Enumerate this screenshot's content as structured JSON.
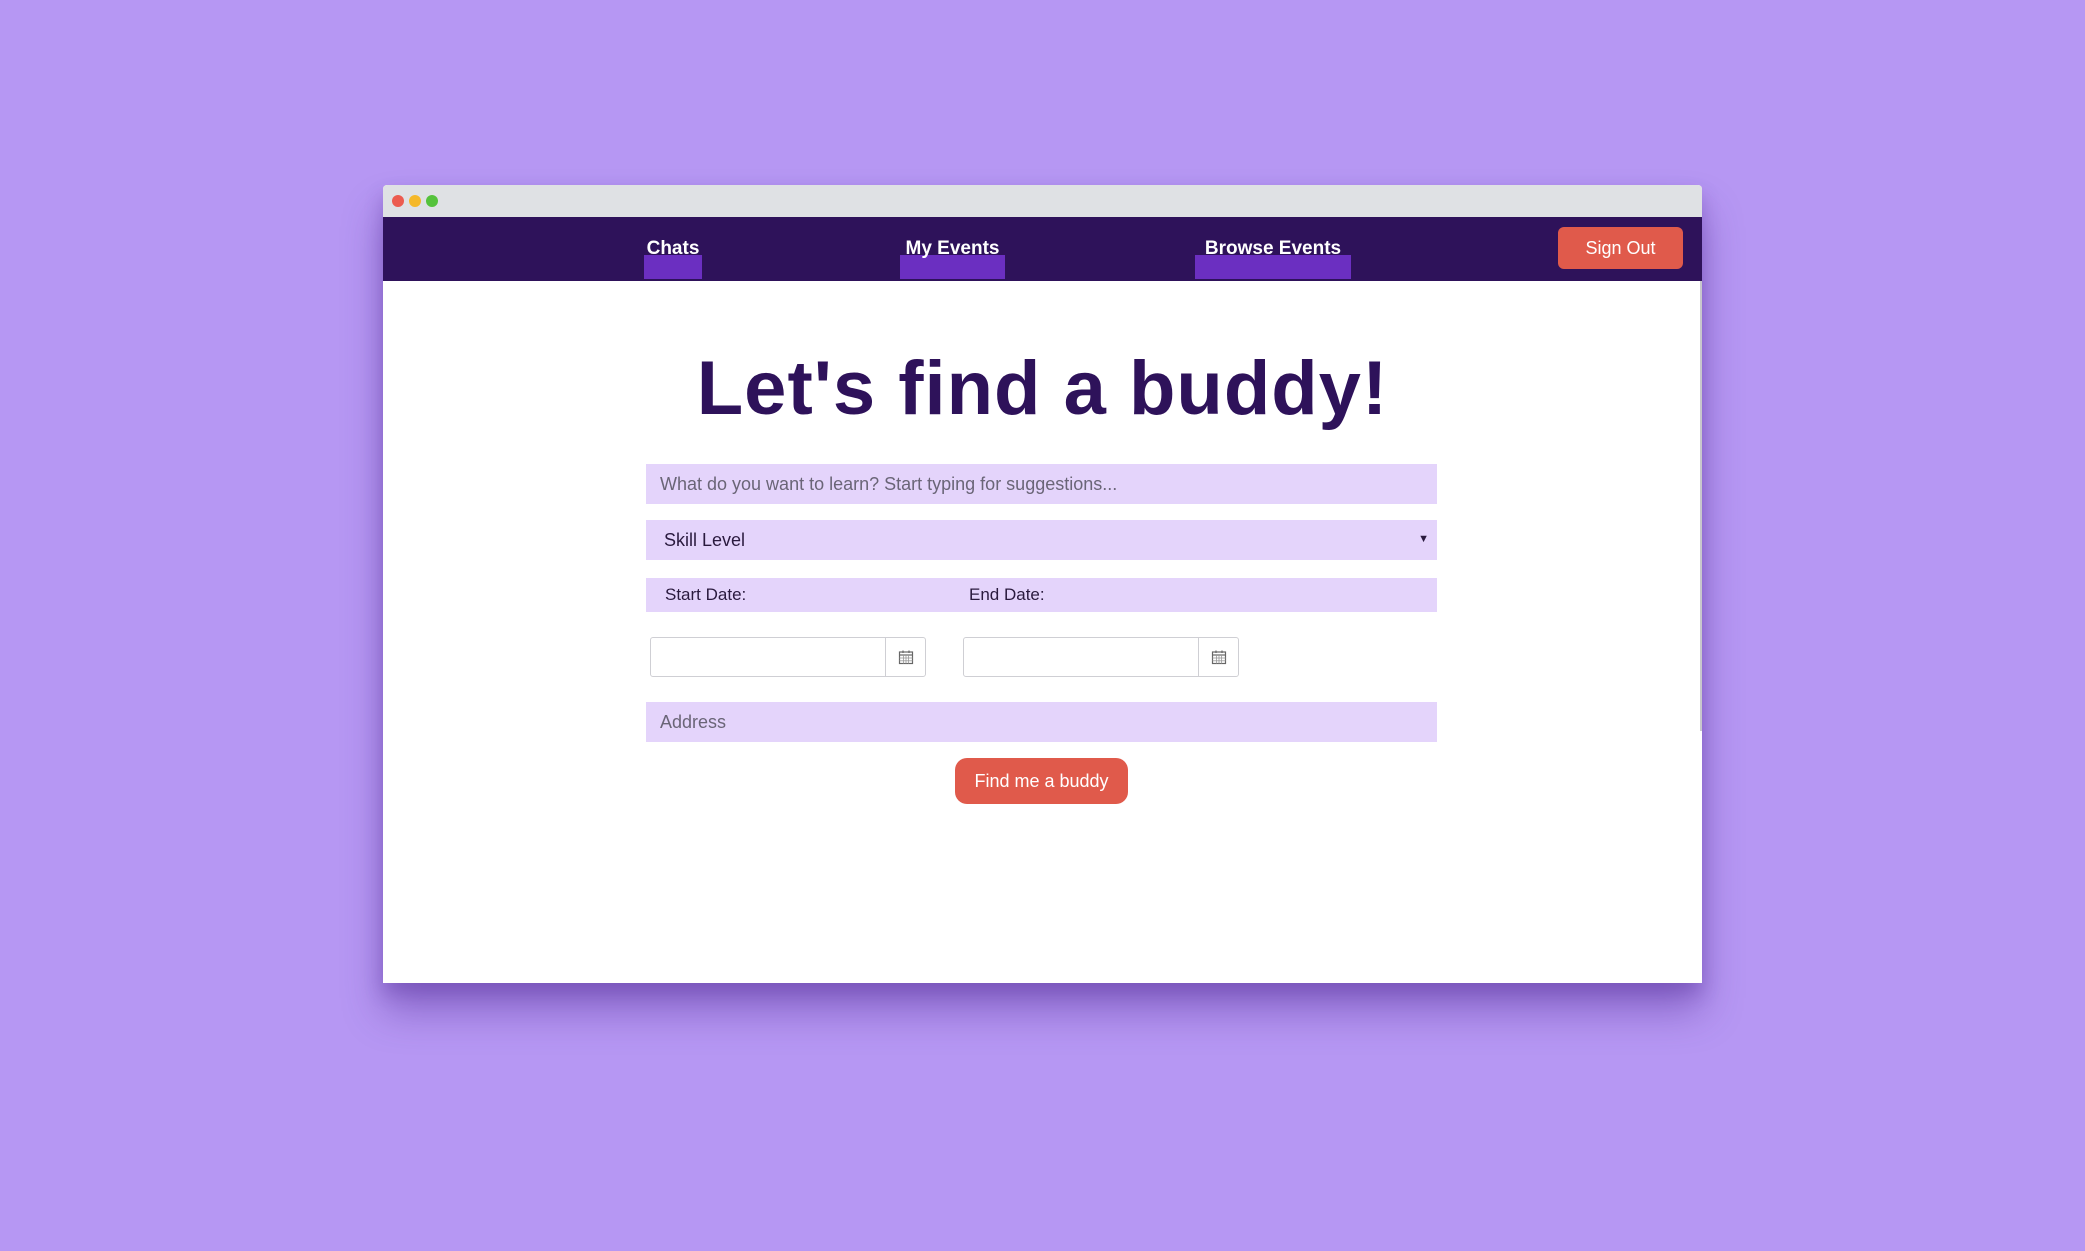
{
  "nav": {
    "links": [
      {
        "label": "Chats"
      },
      {
        "label": "My Events"
      },
      {
        "label": "Browse Events"
      }
    ],
    "signout_label": "Sign Out"
  },
  "main": {
    "heading": "Let's find a buddy!",
    "learn_placeholder": "What do you want to learn? Start typing for suggestions...",
    "skill_level_selected": "Skill Level",
    "start_date_label": "Start Date:",
    "end_date_label": "End Date:",
    "start_date_value": "",
    "end_date_value": "",
    "address_placeholder": "Address",
    "submit_label": "Find me a buddy"
  },
  "colors": {
    "background": "#b697f3",
    "navbar": "#2e125a",
    "nav_highlight": "#6b2fc1",
    "accent_button": "#e05a4b",
    "field_fill": "#e4d4fb",
    "heading_text": "#2e125a"
  },
  "icons": {
    "calendar": "calendar-icon",
    "caret": "chevron-down-icon"
  }
}
